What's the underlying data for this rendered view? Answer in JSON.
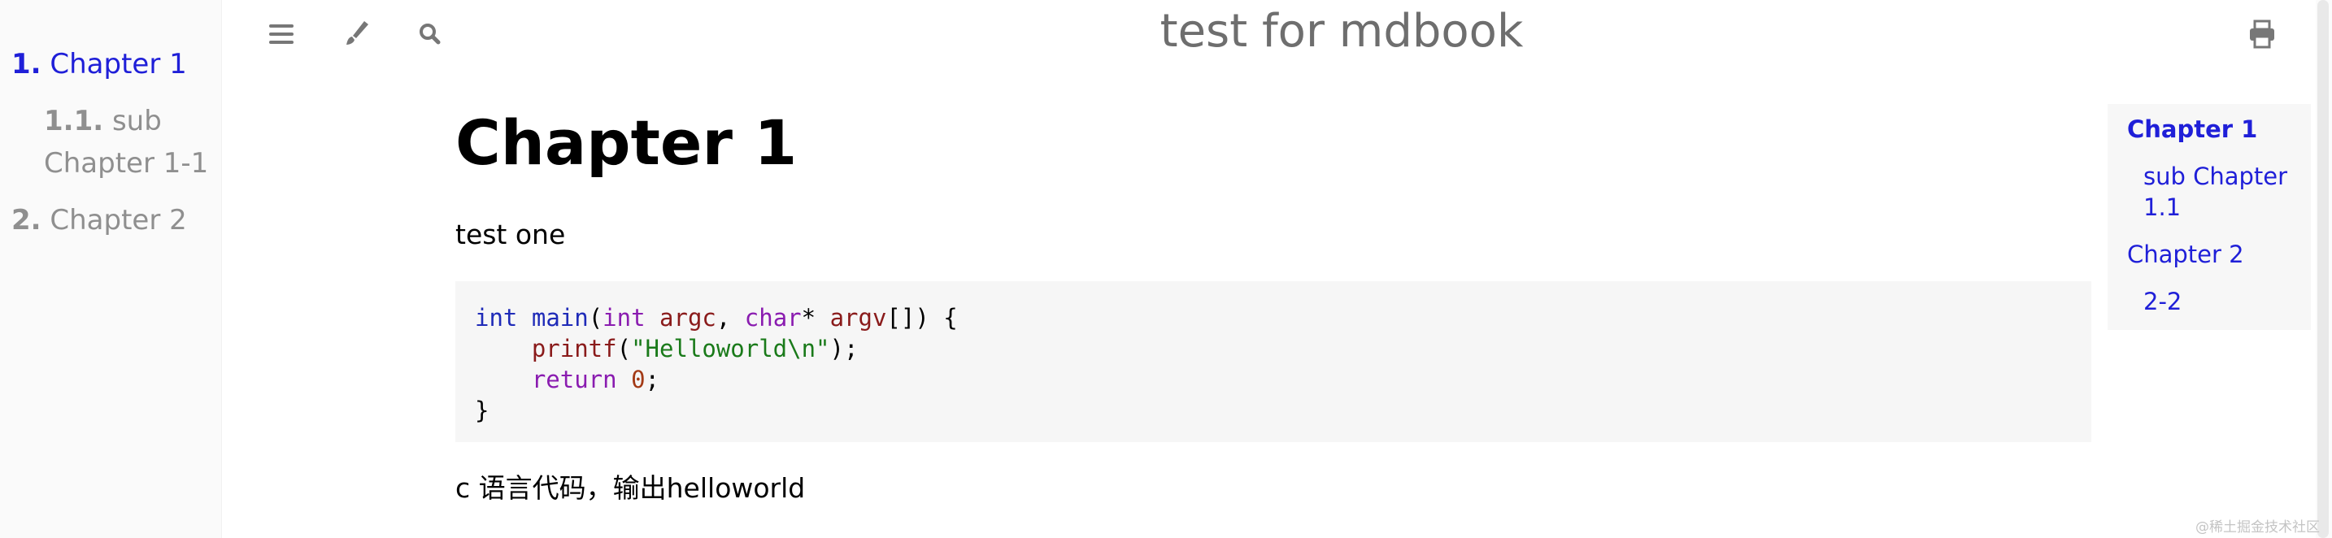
{
  "sidebar": {
    "items": [
      {
        "num": "1.",
        "label": "Chapter 1",
        "active": true
      },
      {
        "num": "1.1.",
        "label": "sub",
        "label2": "Chapter 1-1",
        "active": false
      },
      {
        "num": "2.",
        "label": "Chapter 2",
        "active": false
      }
    ]
  },
  "menu": {
    "title": "test for mdbook",
    "icons": [
      "bars-icon",
      "paintbrush-icon",
      "search-icon",
      "print-icon"
    ]
  },
  "content": {
    "heading": "Chapter 1",
    "paragraph1": "test one",
    "code": {
      "language": "c",
      "lines": [
        "int main(int argc, char* argv[]) {",
        "    printf(\"Helloworld\\n\");",
        "    return 0;",
        "}"
      ]
    },
    "paragraph2": "c 语言代码，输出helloworld"
  },
  "toc": {
    "items": [
      {
        "label": "Chapter 1",
        "current": true
      },
      {
        "label": "sub Chapter",
        "label2": "1.1",
        "current": false
      },
      {
        "label": "Chapter 2",
        "current": false
      },
      {
        "label": "2-2",
        "current": false
      }
    ]
  },
  "watermark": "@稀土掘金技术社区",
  "colors": {
    "link": "#1f1fd8",
    "sidebar_inactive": "#8f8f8f",
    "sidebar_bg": "#fafafa",
    "code_bg": "#f6f6f6"
  }
}
